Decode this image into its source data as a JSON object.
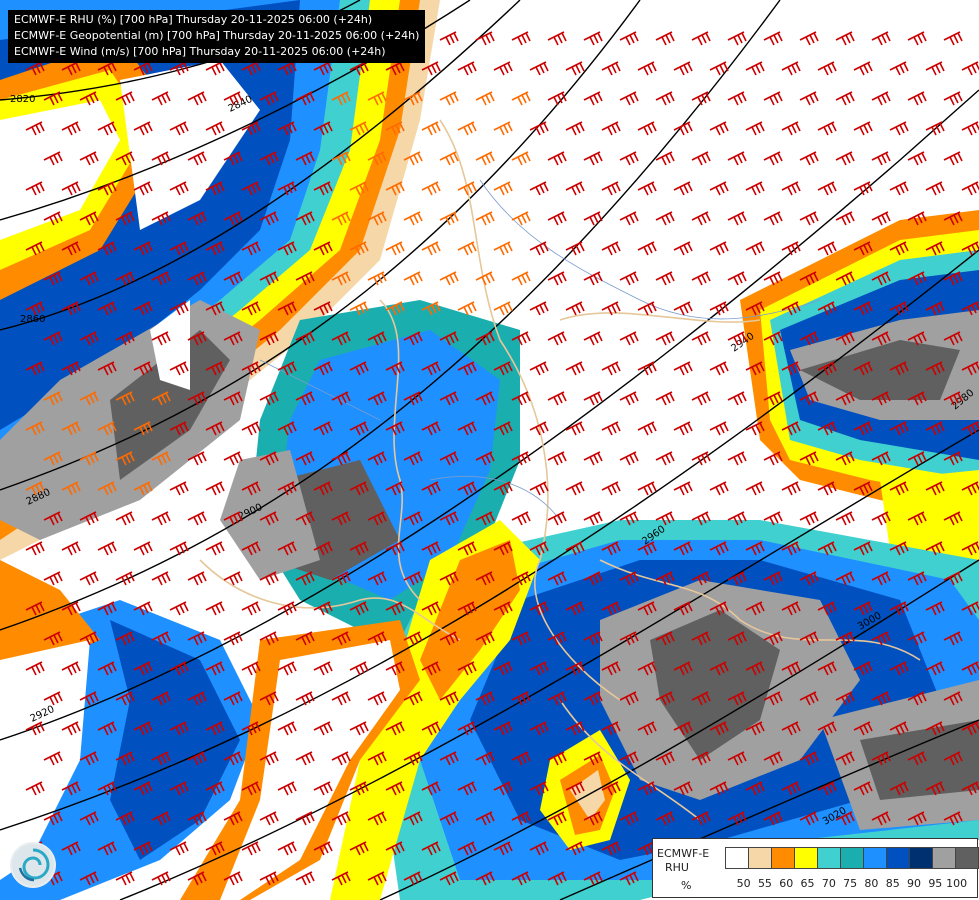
{
  "title_lines": [
    "ECMWF-E RHU (%) [700 hPa] Thursday 20-11-2025 06:00 (+24h)",
    "ECMWF-E Geopotential (m) [700 hPa] Thursday 20-11-2025 06:00 (+24h)",
    "ECMWF-E Wind (m/s) [700 hPa] Thursday 20-11-2025 06:00 (+24h)"
  ],
  "legend": {
    "model": "ECMWF-E",
    "variable": "RHU",
    "unit": "%",
    "labels": [
      "50",
      "55",
      "60",
      "65",
      "70",
      "75",
      "80",
      "85",
      "90",
      "95",
      "100"
    ],
    "colors": [
      "#ffffff",
      "#f5d7a8",
      "#ff8c00",
      "#ffff00",
      "#40d0d0",
      "#1aaeae",
      "#1e90ff",
      "#0050c0",
      "#003070",
      "#a0a0a0",
      "#606060"
    ]
  },
  "contour_labels": [
    "2820",
    "2840",
    "2860",
    "2880",
    "2900",
    "2920",
    "2940",
    "2960",
    "2980",
    "3000",
    "3020"
  ],
  "colors": {
    "contour": "#000000",
    "wind_barb": "#cc0000",
    "wind_barb_light": "#ff6a00",
    "border": "#e6c79a",
    "river": "#7a9ccf"
  },
  "icons": [
    "logo-icon"
  ]
}
